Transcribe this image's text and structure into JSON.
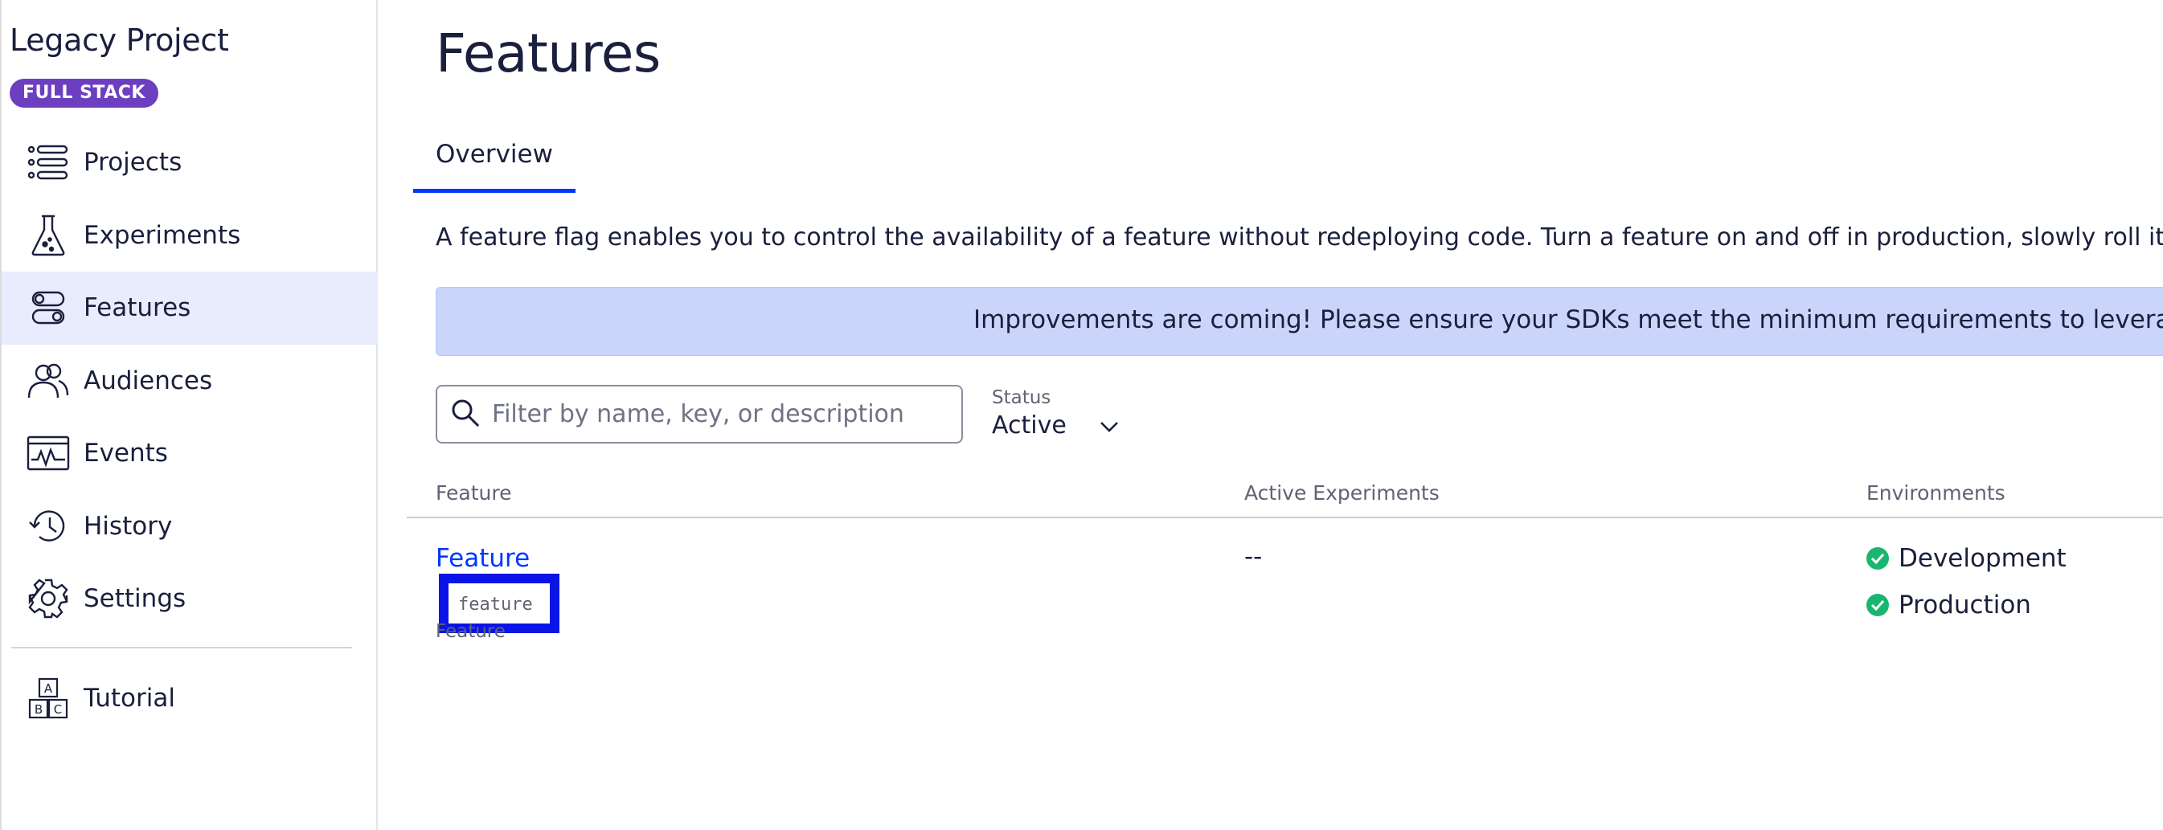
{
  "sidebar": {
    "project_title": "Legacy Project",
    "badge": "FULL STACK",
    "items": [
      {
        "label": "Projects",
        "icon": "projects-list-icon",
        "active": false
      },
      {
        "label": "Experiments",
        "icon": "flask-icon",
        "active": false
      },
      {
        "label": "Features",
        "icon": "toggle-icon",
        "active": true
      },
      {
        "label": "Audiences",
        "icon": "people-icon",
        "active": false
      },
      {
        "label": "Events",
        "icon": "events-chart-icon",
        "active": false
      },
      {
        "label": "History",
        "icon": "history-clock-icon",
        "active": false
      },
      {
        "label": "Settings",
        "icon": "gear-icon",
        "active": false
      }
    ],
    "tutorial": {
      "label": "Tutorial",
      "icon": "abc-blocks-icon"
    }
  },
  "main": {
    "title": "Features",
    "tabs": [
      {
        "label": "Overview",
        "active": true
      }
    ],
    "description": "A feature flag enables you to control the availability of a feature without redeploying code. Turn a feature on and off in production, slowly roll it out, o",
    "banner": "Improvements are coming! Please ensure your SDKs meet the minimum requirements to leverage new",
    "search": {
      "placeholder": "Filter by name, key, or description",
      "value": ""
    },
    "status_filter": {
      "caption": "Status",
      "value": "Active"
    },
    "table": {
      "columns": [
        "Feature",
        "Active Experiments",
        "Environments"
      ],
      "rows": [
        {
          "name": "Feature",
          "key": "feature",
          "description": "Feature",
          "active_experiments": "--",
          "environments": [
            "Development",
            "Production"
          ]
        }
      ]
    }
  },
  "colors": {
    "accent": "#0037ff",
    "badge": "#6c3fc1",
    "active_nav_bg": "#e8ecfc",
    "banner_bg": "#cbd5fb",
    "env_ok": "#19b66f",
    "highlight_box": "#0a14e6"
  }
}
